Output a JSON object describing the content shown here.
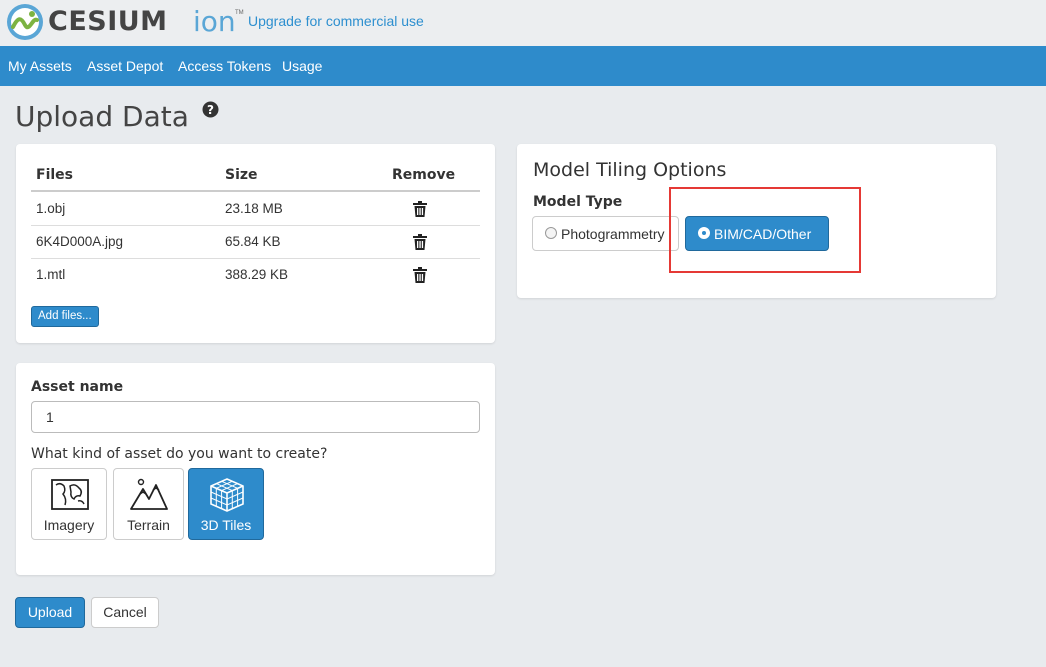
{
  "brand": {
    "name": "CESIUM",
    "product": "ion",
    "upgrade_link": "Upgrade for commercial use"
  },
  "nav": {
    "items": [
      "My Assets",
      "Asset Depot",
      "Access Tokens",
      "Usage"
    ]
  },
  "page": {
    "title": "Upload Data"
  },
  "files_table": {
    "columns": [
      "Files",
      "Size",
      "Remove"
    ],
    "rows": [
      {
        "name": "1.obj",
        "size": "23.18 MB"
      },
      {
        "name": "6K4D000A.jpg",
        "size": "65.84 KB"
      },
      {
        "name": "1.mtl",
        "size": "388.29 KB"
      }
    ],
    "add_files_label": "Add files..."
  },
  "asset": {
    "name_label": "Asset name",
    "name_value": "1",
    "kind_question": "What kind of asset do you want to create?",
    "kinds": [
      {
        "label": "Imagery",
        "icon": "map-icon",
        "selected": false
      },
      {
        "label": "Terrain",
        "icon": "mountains-icon",
        "selected": false
      },
      {
        "label": "3D Tiles",
        "icon": "cube-grid-icon",
        "selected": true
      }
    ]
  },
  "tiling": {
    "title": "Model Tiling Options",
    "model_type_label": "Model Type",
    "options": [
      {
        "label": "Photogrammetry",
        "selected": false
      },
      {
        "label": "BIM/CAD/Other",
        "selected": true
      }
    ]
  },
  "actions": {
    "upload_label": "Upload",
    "cancel_label": "Cancel"
  },
  "colors": {
    "accent": "#2e8bcb",
    "background": "#e8ebee",
    "highlight": "#e53935"
  }
}
